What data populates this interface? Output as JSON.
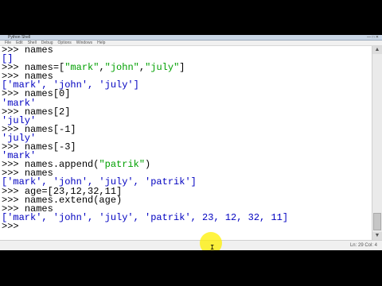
{
  "window": {
    "title": "Python Shell"
  },
  "menu": [
    "File",
    "Edit",
    "Shell",
    "Debug",
    "Options",
    "Windows",
    "Help"
  ],
  "console_lines": [
    {
      "prompt": ">>> ",
      "code": "names",
      "type": "input"
    },
    {
      "text": "[]",
      "type": "output"
    },
    {
      "prompt": ">>> ",
      "code": "names=[\"mark\",\"john\",\"july\"]",
      "type": "input"
    },
    {
      "prompt": ">>> ",
      "code": "names",
      "type": "input"
    },
    {
      "text": "['mark', 'john', 'july']",
      "type": "output"
    },
    {
      "prompt": ">>> ",
      "code": "names[0]",
      "type": "input"
    },
    {
      "text": "'mark'",
      "type": "output"
    },
    {
      "prompt": ">>> ",
      "code": "names[2]",
      "type": "input"
    },
    {
      "text": "'july'",
      "type": "output"
    },
    {
      "prompt": ">>> ",
      "code": "names[-1]",
      "type": "input"
    },
    {
      "text": "'july'",
      "type": "output"
    },
    {
      "prompt": ">>> ",
      "code": "names[-3]",
      "type": "input"
    },
    {
      "text": "'mark'",
      "type": "output"
    },
    {
      "prompt": ">>> ",
      "code": "names.append(\"patrik\")",
      "type": "input"
    },
    {
      "prompt": ">>> ",
      "code": "names",
      "type": "input"
    },
    {
      "text": "['mark', 'john', 'july', 'patrik']",
      "type": "output"
    },
    {
      "prompt": ">>> ",
      "code": "age=[23,12,32,11]",
      "type": "input"
    },
    {
      "prompt": ">>> ",
      "code": "names.extend(age)",
      "type": "input"
    },
    {
      "prompt": ">>> ",
      "code": "names",
      "type": "input"
    },
    {
      "text": "['mark', 'john', 'july', 'patrik', 23, 12, 32, 11]",
      "type": "output"
    },
    {
      "prompt": ">>> ",
      "code": "",
      "type": "input"
    }
  ],
  "status": {
    "position": "Ln: 29 Col: 4"
  },
  "colors": {
    "output": "#0000c0",
    "string": "#00a000",
    "highlight": "#fff000"
  },
  "icons": {
    "scroll_up": "triangle-up",
    "scroll_down": "triangle-down"
  }
}
